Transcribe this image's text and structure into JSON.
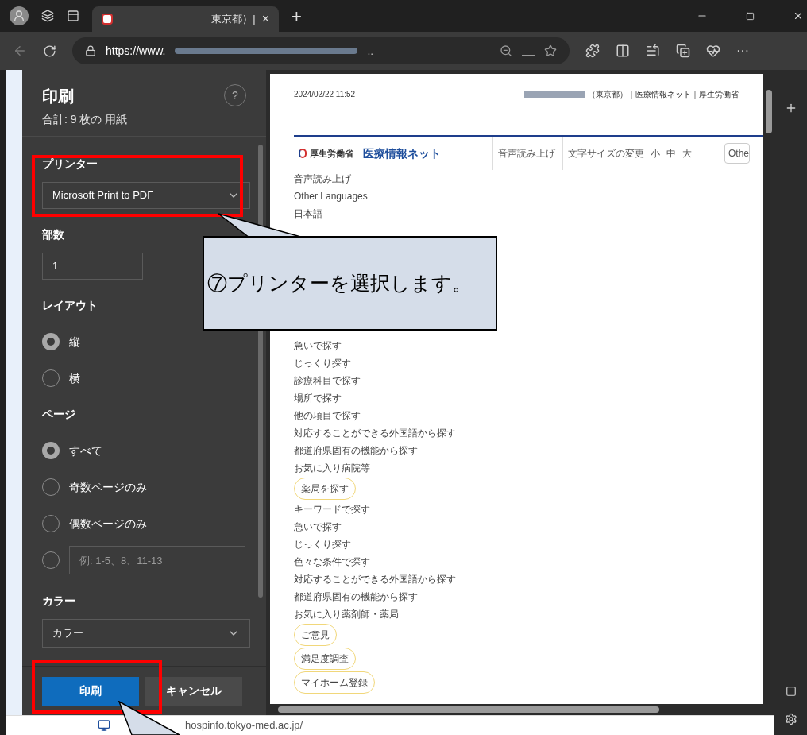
{
  "browser": {
    "tab_title": "東京都）|",
    "close_tab": "×",
    "new_tab": "+",
    "url_prefix": "https://www.",
    "url_rest": "..",
    "more": "···"
  },
  "dialog": {
    "title": "印刷",
    "summary": "合計: 9 枚の 用紙",
    "help": "?",
    "printer": {
      "label": "プリンター",
      "value": "Microsoft Print to PDF"
    },
    "copies": {
      "label": "部数",
      "value": "1"
    },
    "layout": {
      "label": "レイアウト",
      "options": [
        {
          "label": "縦",
          "selected": true
        },
        {
          "label": "横",
          "selected": false
        }
      ]
    },
    "pages": {
      "label": "ページ",
      "options": [
        {
          "kind": "radio",
          "label": "すべて",
          "selected": true
        },
        {
          "kind": "radio",
          "label": "奇数ページのみ",
          "selected": false
        },
        {
          "kind": "radio",
          "label": "偶数ページのみ",
          "selected": false
        },
        {
          "kind": "input",
          "placeholder": "例: 1-5、8、11-13",
          "selected": false
        }
      ]
    },
    "color": {
      "label": "カラー",
      "value": "カラー"
    },
    "buttons": [
      {
        "kind": "primary",
        "label": "印刷"
      },
      {
        "kind": "secondary",
        "label": "キャンセル"
      }
    ]
  },
  "preview": {
    "timestamp": "2024/02/22 11:52",
    "header_title": "（東京都）｜医療情報ネット｜厚生労働省",
    "logo_text": "厚生労働省",
    "site_name": "医療情報ネット",
    "read_aloud": "音声読み上げ",
    "text_size": "文字サイズの変更",
    "sizes": [
      "小",
      "中",
      "大"
    ],
    "language_cut": "Othe",
    "items": [
      {
        "kind": "link",
        "label": "音声読み上げ"
      },
      {
        "kind": "link",
        "label": "Other Languages"
      },
      {
        "kind": "link",
        "label": "日本語"
      },
      {
        "kind": "gap"
      },
      {
        "kind": "link",
        "label": "急いで探す"
      },
      {
        "kind": "link",
        "label": "じっくり探す"
      },
      {
        "kind": "link",
        "label": "診療科目で探す"
      },
      {
        "kind": "link",
        "label": "場所で探す"
      },
      {
        "kind": "link",
        "label": "他の項目で探す"
      },
      {
        "kind": "link",
        "label": "対応することができる外国語から探す"
      },
      {
        "kind": "link",
        "label": "都道府県固有の機能から探す"
      },
      {
        "kind": "link",
        "label": "お気に入り病院等"
      },
      {
        "kind": "pill",
        "label": "薬局を探す"
      },
      {
        "kind": "link",
        "label": "キーワードで探す"
      },
      {
        "kind": "link",
        "label": "急いで探す"
      },
      {
        "kind": "link",
        "label": "じっくり探す"
      },
      {
        "kind": "link",
        "label": "色々な条件で探す"
      },
      {
        "kind": "link",
        "label": "対応することができる外国語から探す"
      },
      {
        "kind": "link",
        "label": "都道府県固有の機能から探す"
      },
      {
        "kind": "link",
        "label": "お気に入り薬剤師・薬局"
      },
      {
        "kind": "pill",
        "label": "ご意見"
      },
      {
        "kind": "pill",
        "label": "満足度調査"
      },
      {
        "kind": "pill",
        "label": "マイホーム登録"
      }
    ]
  },
  "page_behind": {
    "url": "hospinfo.tokyo-med.ac.jp/"
  },
  "callout": {
    "text": "⑦プリンターを選択します。"
  }
}
